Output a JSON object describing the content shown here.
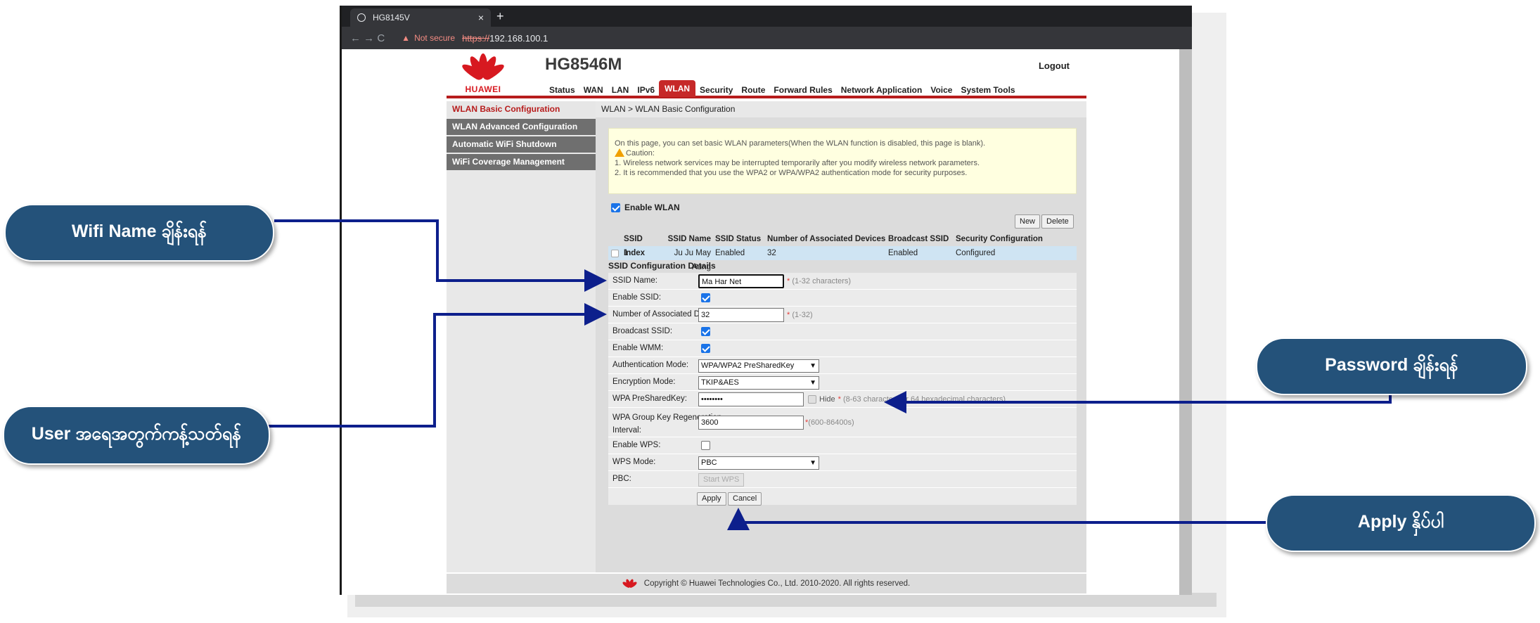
{
  "browser": {
    "tab_title": "HG8145V",
    "tab_close": "×",
    "new_tab": "+",
    "nav_icons": "← → C",
    "not_secure": "Not secure",
    "protocol": "https://",
    "url": "192.168.100.1"
  },
  "router": {
    "brand": "HUAWEI",
    "model": "HG8546M",
    "logout": "Logout",
    "nav": [
      "Status",
      "WAN",
      "LAN",
      "IPv6",
      "WLAN",
      "Security",
      "Route",
      "Forward Rules",
      "Network Application",
      "Voice",
      "System Tools"
    ],
    "active_nav": "WLAN",
    "sidebar": [
      "WLAN Basic Configuration",
      "WLAN Advanced Configuration",
      "Automatic WiFi Shutdown",
      "WiFi Coverage Management"
    ],
    "breadcrumb": "WLAN > WLAN Basic Configuration",
    "info": {
      "line1": "On this page, you can set basic WLAN parameters(When the WLAN function is disabled, this page is blank).",
      "caution": "Caution:",
      "line2": "1. Wireless network services may be interrupted temporarily after you modify wireless network parameters.",
      "line3": "2. It is recommended that you use the WPA2 or WPA/WPA2 authentication mode for security purposes."
    },
    "enable_wlan": {
      "label": "Enable WLAN",
      "checked": true
    },
    "buttons": {
      "new": "New",
      "delete": "Delete",
      "apply": "Apply",
      "cancel": "Cancel",
      "start_wps": "Start WPS"
    },
    "table": {
      "headers": [
        "SSID Index",
        "SSID Name",
        "SSID Status",
        "Number of Associated Devices",
        "Broadcast SSID",
        "Security Configuration"
      ],
      "rows": [
        [
          "1",
          "Ju Ju May Aung",
          "Enabled",
          "32",
          "Enabled",
          "Configured"
        ]
      ]
    },
    "details_title": "SSID Configuration Details",
    "form": {
      "ssid_name": {
        "label": "SSID Name:",
        "value": "Ma Har Net",
        "hint": "(1-32 characters)"
      },
      "enable_ssid": {
        "label": "Enable SSID:",
        "checked": true
      },
      "num_devices": {
        "label": "Number of Associated Devices:",
        "value": "32",
        "hint": "(1-32)"
      },
      "broadcast_ssid": {
        "label": "Broadcast SSID:",
        "checked": true
      },
      "enable_wmm": {
        "label": "Enable WMM:",
        "checked": true
      },
      "auth_mode": {
        "label": "Authentication Mode:",
        "value": "WPA/WPA2 PreSharedKey"
      },
      "enc_mode": {
        "label": "Encryption Mode:",
        "value": "TKIP&AES"
      },
      "psk": {
        "label": "WPA PreSharedKey:",
        "value": "••••••••",
        "hide": "Hide",
        "hint": "(8-63 characters or 64 hexadecimal characters)"
      },
      "group_key": {
        "label1": "WPA Group Key Regeneration",
        "label2": "Interval:",
        "value": "3600",
        "hint": "(600-86400s)"
      },
      "enable_wps": {
        "label": "Enable WPS:",
        "checked": false
      },
      "wps_mode": {
        "label": "WPS Mode:",
        "value": "PBC"
      },
      "pbc": {
        "label": "PBC:"
      }
    },
    "required_mark": "*",
    "footer": "Copyright © Huawei Technologies Co., Ltd. 2010-2020. All rights reserved."
  },
  "callouts": {
    "wifi_name": "Wifi  Name ချိန်းရန်",
    "user_limit": "User အရေအတွက်ကန့်သတ်ရန်",
    "password": "Password ချိန်းရန်",
    "apply": "Apply နှိပ်ပါ"
  },
  "colors": {
    "callout_bg": "#24527a",
    "arrow": "#0d1f8c",
    "huawei_red": "#c62828"
  },
  "icons": [
    "globe-icon",
    "back-icon",
    "forward-icon",
    "reload-icon",
    "warning-icon",
    "huawei-logo",
    "caution-icon",
    "checkbox-icon",
    "chevron-down-icon"
  ]
}
